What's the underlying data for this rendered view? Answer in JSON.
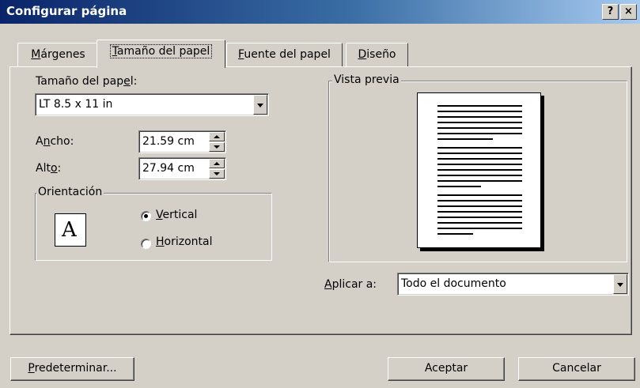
{
  "window": {
    "title": "Configurar página",
    "help_label": "?",
    "close_label": "×"
  },
  "tabs": [
    {
      "pre": "",
      "acc": "M",
      "post": "árgenes"
    },
    {
      "pre": "",
      "acc": "T",
      "post": "amaño del papel"
    },
    {
      "pre": "",
      "acc": "F",
      "post": "uente del papel"
    },
    {
      "pre": "",
      "acc": "D",
      "post": "iseño"
    }
  ],
  "paper_size": {
    "label_pre": "Tamaño del pap",
    "label_acc": "e",
    "label_post": "l:",
    "value": "LT 8.5 x 11 in"
  },
  "width": {
    "label_pre": "A",
    "label_acc": "n",
    "label_post": "cho:",
    "value": "21.59 cm"
  },
  "height": {
    "label_pre": "Alt",
    "label_acc": "o",
    "label_post": ":",
    "value": "27.94 cm"
  },
  "orientation": {
    "legend": "Orientación",
    "icon_letter": "A",
    "vertical": {
      "acc": "V",
      "post": "ertical",
      "checked": true
    },
    "horizontal": {
      "acc": "H",
      "post": "orizontal",
      "checked": false
    }
  },
  "preview": {
    "legend": "Vista previa"
  },
  "apply": {
    "label_acc": "A",
    "label_post": "plicar a:",
    "value": "Todo el documento"
  },
  "buttons": {
    "default": {
      "acc": "P",
      "post": "redeterminar..."
    },
    "ok": "Aceptar",
    "cancel": "Cancelar"
  }
}
